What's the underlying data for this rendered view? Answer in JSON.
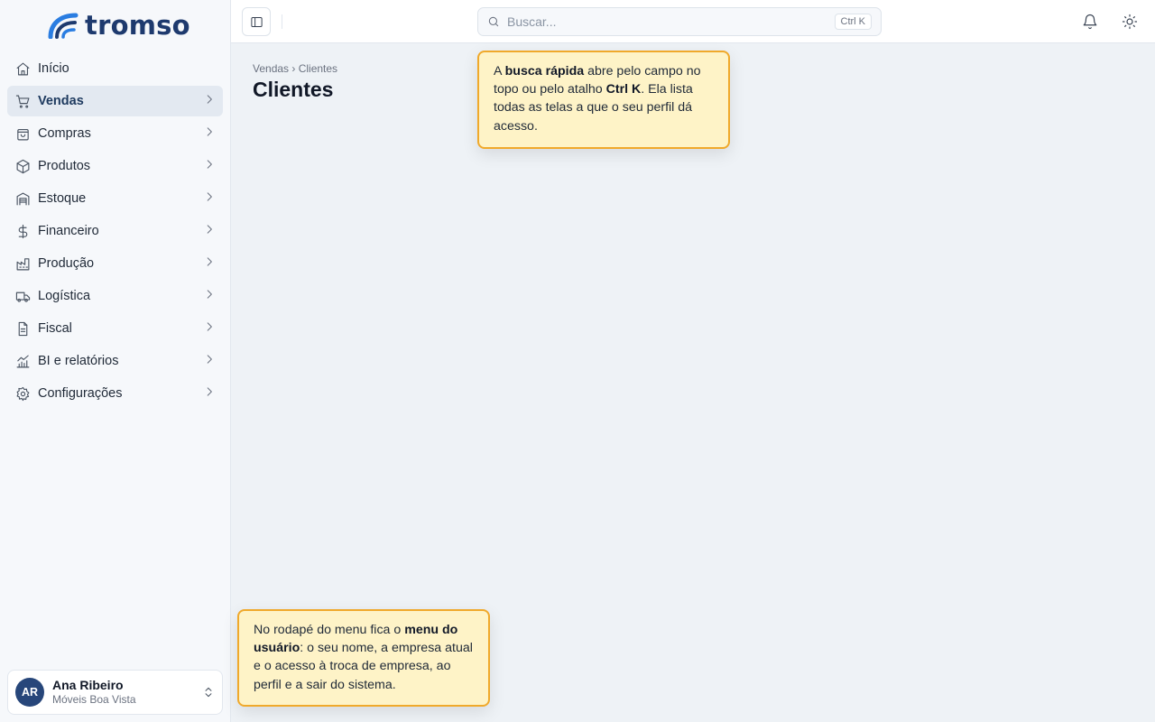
{
  "brand": {
    "name": "tromso",
    "color": "#1e3a6e"
  },
  "sidebar": {
    "items": [
      {
        "label": "Início",
        "icon": "home-icon",
        "has_chevron": false,
        "active": false
      },
      {
        "label": "Vendas",
        "icon": "cart-icon",
        "has_chevron": true,
        "active": true
      },
      {
        "label": "Compras",
        "icon": "shopping-bag-icon",
        "has_chevron": true,
        "active": false
      },
      {
        "label": "Produtos",
        "icon": "package-icon",
        "has_chevron": true,
        "active": false
      },
      {
        "label": "Estoque",
        "icon": "warehouse-icon",
        "has_chevron": true,
        "active": false
      },
      {
        "label": "Financeiro",
        "icon": "dollar-icon",
        "has_chevron": true,
        "active": false
      },
      {
        "label": "Produção",
        "icon": "factory-icon",
        "has_chevron": true,
        "active": false
      },
      {
        "label": "Logística",
        "icon": "truck-icon",
        "has_chevron": true,
        "active": false
      },
      {
        "label": "Fiscal",
        "icon": "file-text-icon",
        "has_chevron": true,
        "active": false
      },
      {
        "label": "BI e relatórios",
        "icon": "chart-icon",
        "has_chevron": true,
        "active": false
      },
      {
        "label": "Configurações",
        "icon": "settings-icon",
        "has_chevron": true,
        "active": false
      }
    ],
    "user": {
      "initials": "AR",
      "name": "Ana Ribeiro",
      "company": "Móveis Boa Vista"
    }
  },
  "topbar": {
    "search_placeholder": "Buscar...",
    "search_shortcut": "Ctrl K"
  },
  "main": {
    "breadcrumb": "Vendas › Clientes",
    "title": "Clientes"
  },
  "tooltips": {
    "search": {
      "t1": "A ",
      "b1": "busca rápida",
      "t2": " abre pelo campo no topo ou pelo atalho ",
      "b2": "Ctrl K",
      "t3": ". Ela lista todas as telas a que o seu perfil dá acesso."
    },
    "user_menu": {
      "t1": "No rodapé do menu fica o ",
      "b1": "menu do usuário",
      "t2": ": o seu nome, a empresa atual e o acesso à troca de empresa, ao perfil e a sair do sistema."
    }
  },
  "colors": {
    "accent": "#27467a",
    "tooltip_bg": "#fef3c7",
    "tooltip_border": "#f0a92b",
    "active_item_bg": "#e3e9f1"
  }
}
